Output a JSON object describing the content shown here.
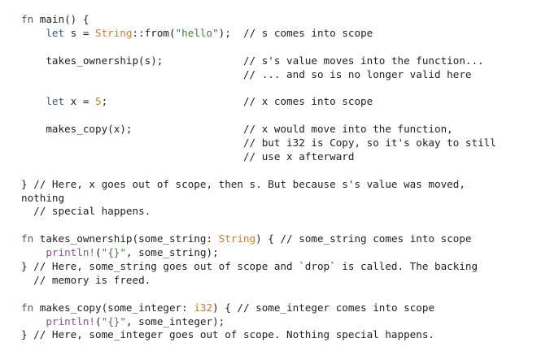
{
  "colors": {
    "background": "#ffffff",
    "text": "#1f1f1f",
    "keyword": "#2f5f8a",
    "type": "#c77c2e",
    "string": "#3f7a3f",
    "number": "#c77c2e",
    "macro": "#8a4f9e"
  },
  "code": {
    "language": "rust",
    "lines": [
      [
        {
          "t": "kw",
          "v": "fn"
        },
        {
          "t": "plain",
          "v": " main() {"
        }
      ],
      [
        {
          "t": "plain",
          "v": "    "
        },
        {
          "t": "kw",
          "v": "let"
        },
        {
          "t": "plain",
          "v": " s = "
        },
        {
          "t": "type",
          "v": "String"
        },
        {
          "t": "plain",
          "v": "::from("
        },
        {
          "t": "str",
          "v": "\"hello\""
        },
        {
          "t": "plain",
          "v": ");  "
        },
        {
          "t": "comment",
          "v": "// s comes into scope"
        }
      ],
      [],
      [
        {
          "t": "plain",
          "v": "    takes_ownership(s);             "
        },
        {
          "t": "comment",
          "v": "// s's value moves into the function..."
        }
      ],
      [
        {
          "t": "plain",
          "v": "                                    "
        },
        {
          "t": "comment",
          "v": "// ... and so is no longer valid here"
        }
      ],
      [],
      [
        {
          "t": "plain",
          "v": "    "
        },
        {
          "t": "kw",
          "v": "let"
        },
        {
          "t": "plain",
          "v": " x = "
        },
        {
          "t": "num",
          "v": "5"
        },
        {
          "t": "plain",
          "v": ";                      "
        },
        {
          "t": "comment",
          "v": "// x comes into scope"
        }
      ],
      [],
      [
        {
          "t": "plain",
          "v": "    makes_copy(x);                  "
        },
        {
          "t": "comment",
          "v": "// x would move into the function,"
        }
      ],
      [
        {
          "t": "plain",
          "v": "                                    "
        },
        {
          "t": "comment",
          "v": "// but i32 is Copy, so it's okay to still"
        }
      ],
      [
        {
          "t": "plain",
          "v": "                                    "
        },
        {
          "t": "comment",
          "v": "// use x afterward"
        }
      ],
      [],
      [
        {
          "t": "plain",
          "v": "} "
        },
        {
          "t": "comment",
          "v": "// Here, x goes out of scope, then s. But because s's value was moved,"
        }
      ],
      [
        {
          "t": "comment",
          "v": "nothing"
        }
      ],
      [
        {
          "t": "plain",
          "v": "  "
        },
        {
          "t": "comment",
          "v": "// special happens."
        }
      ],
      [],
      [
        {
          "t": "kw",
          "v": "fn"
        },
        {
          "t": "plain",
          "v": " takes_ownership(some_string: "
        },
        {
          "t": "type",
          "v": "String"
        },
        {
          "t": "plain",
          "v": ") { "
        },
        {
          "t": "comment",
          "v": "// some_string comes into scope"
        }
      ],
      [
        {
          "t": "plain",
          "v": "    "
        },
        {
          "t": "macro",
          "v": "println!"
        },
        {
          "t": "plain",
          "v": "("
        },
        {
          "t": "str",
          "v": "\"{}\""
        },
        {
          "t": "plain",
          "v": ", some_string);"
        }
      ],
      [
        {
          "t": "plain",
          "v": "} "
        },
        {
          "t": "comment",
          "v": "// Here, some_string goes out of scope and `drop` is called. The backing"
        }
      ],
      [
        {
          "t": "plain",
          "v": "  "
        },
        {
          "t": "comment",
          "v": "// memory is freed."
        }
      ],
      [],
      [
        {
          "t": "kw",
          "v": "fn"
        },
        {
          "t": "plain",
          "v": " makes_copy(some_integer: "
        },
        {
          "t": "type",
          "v": "i32"
        },
        {
          "t": "plain",
          "v": ") { "
        },
        {
          "t": "comment",
          "v": "// some_integer comes into scope"
        }
      ],
      [
        {
          "t": "plain",
          "v": "    "
        },
        {
          "t": "macro",
          "v": "println!"
        },
        {
          "t": "plain",
          "v": "("
        },
        {
          "t": "str",
          "v": "\"{}\""
        },
        {
          "t": "plain",
          "v": ", some_integer);"
        }
      ],
      [
        {
          "t": "plain",
          "v": "} "
        },
        {
          "t": "comment",
          "v": "// Here, some_integer goes out of scope. Nothing special happens."
        }
      ]
    ]
  }
}
